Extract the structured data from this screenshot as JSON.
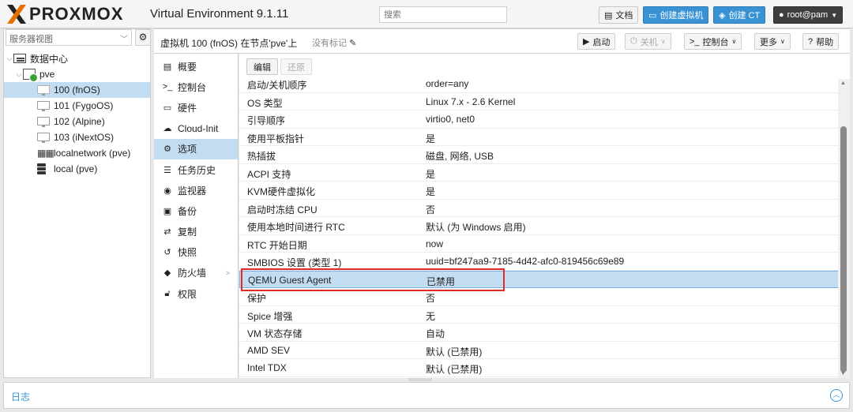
{
  "header": {
    "brand": "PROXMOX",
    "version": "Virtual Environment 9.1.11",
    "search_placeholder": "搜索",
    "docs": "文档",
    "create_vm": "创建虚拟机",
    "create_ct": "创建 CT",
    "user": "root@pam"
  },
  "left": {
    "view": "服务器视图",
    "tree": [
      {
        "label": "数据中心",
        "type": "datacenter"
      },
      {
        "label": "pve",
        "type": "node"
      },
      {
        "label": "100 (fnOS)",
        "type": "vm",
        "selected": true
      },
      {
        "label": "101 (FygoOS)",
        "type": "vm"
      },
      {
        "label": "102 (Alpine)",
        "type": "vm"
      },
      {
        "label": "103 (iNextOS)",
        "type": "vm"
      },
      {
        "label": "localnetwork (pve)",
        "type": "network"
      },
      {
        "label": "local (pve)",
        "type": "storage"
      }
    ]
  },
  "vmhead": {
    "title": "虚拟机 100 (fnOS) 在节点'pve'上",
    "no_tags": "没有标记",
    "start": "启动",
    "shutdown": "关机",
    "console": "控制台",
    "more": "更多",
    "help": "帮助"
  },
  "submenu": [
    {
      "label": "概要",
      "icon": "book-icon"
    },
    {
      "label": "控制台",
      "icon": "terminal-icon"
    },
    {
      "label": "硬件",
      "icon": "desktop-icon"
    },
    {
      "label": "Cloud-Init",
      "icon": "cloud-icon"
    },
    {
      "label": "选项",
      "icon": "gear-icon",
      "selected": true
    },
    {
      "label": "任务历史",
      "icon": "list-icon"
    },
    {
      "label": "监视器",
      "icon": "eye-icon"
    },
    {
      "label": "备份",
      "icon": "floppy-icon"
    },
    {
      "label": "复制",
      "icon": "retweet-icon"
    },
    {
      "label": "快照",
      "icon": "history-icon"
    },
    {
      "label": "防火墙",
      "icon": "shield-icon"
    },
    {
      "label": "权限",
      "icon": "unlock-icon"
    }
  ],
  "toolbar": {
    "edit": "编辑",
    "revert": "还原"
  },
  "options": [
    {
      "key": "启动/关机顺序",
      "value": "order=any"
    },
    {
      "key": "OS 类型",
      "value": "Linux 7.x - 2.6 Kernel"
    },
    {
      "key": "引导顺序",
      "value": "virtio0, net0"
    },
    {
      "key": "使用平板指针",
      "value": "是"
    },
    {
      "key": "热插拔",
      "value": "磁盘, 网络, USB"
    },
    {
      "key": "ACPI 支持",
      "value": "是"
    },
    {
      "key": "KVM硬件虚拟化",
      "value": "是"
    },
    {
      "key": "启动时冻结 CPU",
      "value": "否"
    },
    {
      "key": "使用本地时间进行 RTC",
      "value": "默认 (为 Windows 启用)"
    },
    {
      "key": "RTC 开始日期",
      "value": "now"
    },
    {
      "key": "SMBIOS 设置 (类型 1)",
      "value": "uuid=bf247aa9-7185-4d42-afc0-819456c69e89"
    },
    {
      "key": "QEMU Guest Agent",
      "value": "已禁用",
      "selected": true
    },
    {
      "key": "保护",
      "value": "否"
    },
    {
      "key": "Spice 增强",
      "value": "无"
    },
    {
      "key": "VM 状态存储",
      "value": "自动"
    },
    {
      "key": "AMD SEV",
      "value": "默认 (已禁用)"
    },
    {
      "key": "Intel TDX",
      "value": "默认 (已禁用)"
    }
  ],
  "log": {
    "title": "日志"
  }
}
